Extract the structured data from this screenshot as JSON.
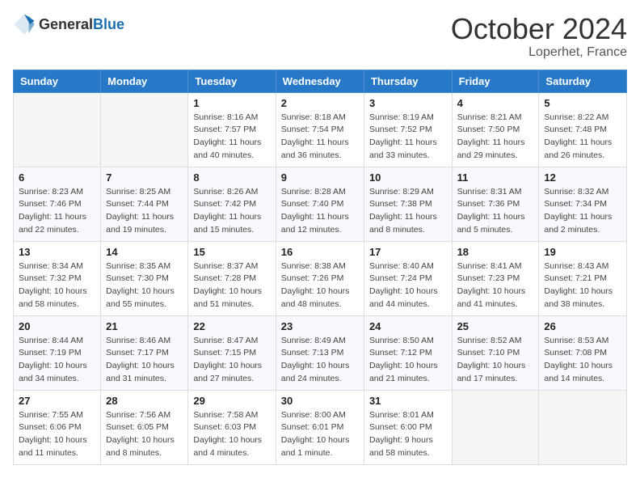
{
  "header": {
    "logo": {
      "general": "General",
      "blue": "Blue"
    },
    "month": "October 2024",
    "location": "Loperhet, France"
  },
  "days_of_week": [
    "Sunday",
    "Monday",
    "Tuesday",
    "Wednesday",
    "Thursday",
    "Friday",
    "Saturday"
  ],
  "weeks": [
    [
      {
        "day": "",
        "sunrise": "",
        "sunset": "",
        "daylight": ""
      },
      {
        "day": "",
        "sunrise": "",
        "sunset": "",
        "daylight": ""
      },
      {
        "day": "1",
        "sunrise": "Sunrise: 8:16 AM",
        "sunset": "Sunset: 7:57 PM",
        "daylight": "Daylight: 11 hours and 40 minutes."
      },
      {
        "day": "2",
        "sunrise": "Sunrise: 8:18 AM",
        "sunset": "Sunset: 7:54 PM",
        "daylight": "Daylight: 11 hours and 36 minutes."
      },
      {
        "day": "3",
        "sunrise": "Sunrise: 8:19 AM",
        "sunset": "Sunset: 7:52 PM",
        "daylight": "Daylight: 11 hours and 33 minutes."
      },
      {
        "day": "4",
        "sunrise": "Sunrise: 8:21 AM",
        "sunset": "Sunset: 7:50 PM",
        "daylight": "Daylight: 11 hours and 29 minutes."
      },
      {
        "day": "5",
        "sunrise": "Sunrise: 8:22 AM",
        "sunset": "Sunset: 7:48 PM",
        "daylight": "Daylight: 11 hours and 26 minutes."
      }
    ],
    [
      {
        "day": "6",
        "sunrise": "Sunrise: 8:23 AM",
        "sunset": "Sunset: 7:46 PM",
        "daylight": "Daylight: 11 hours and 22 minutes."
      },
      {
        "day": "7",
        "sunrise": "Sunrise: 8:25 AM",
        "sunset": "Sunset: 7:44 PM",
        "daylight": "Daylight: 11 hours and 19 minutes."
      },
      {
        "day": "8",
        "sunrise": "Sunrise: 8:26 AM",
        "sunset": "Sunset: 7:42 PM",
        "daylight": "Daylight: 11 hours and 15 minutes."
      },
      {
        "day": "9",
        "sunrise": "Sunrise: 8:28 AM",
        "sunset": "Sunset: 7:40 PM",
        "daylight": "Daylight: 11 hours and 12 minutes."
      },
      {
        "day": "10",
        "sunrise": "Sunrise: 8:29 AM",
        "sunset": "Sunset: 7:38 PM",
        "daylight": "Daylight: 11 hours and 8 minutes."
      },
      {
        "day": "11",
        "sunrise": "Sunrise: 8:31 AM",
        "sunset": "Sunset: 7:36 PM",
        "daylight": "Daylight: 11 hours and 5 minutes."
      },
      {
        "day": "12",
        "sunrise": "Sunrise: 8:32 AM",
        "sunset": "Sunset: 7:34 PM",
        "daylight": "Daylight: 11 hours and 2 minutes."
      }
    ],
    [
      {
        "day": "13",
        "sunrise": "Sunrise: 8:34 AM",
        "sunset": "Sunset: 7:32 PM",
        "daylight": "Daylight: 10 hours and 58 minutes."
      },
      {
        "day": "14",
        "sunrise": "Sunrise: 8:35 AM",
        "sunset": "Sunset: 7:30 PM",
        "daylight": "Daylight: 10 hours and 55 minutes."
      },
      {
        "day": "15",
        "sunrise": "Sunrise: 8:37 AM",
        "sunset": "Sunset: 7:28 PM",
        "daylight": "Daylight: 10 hours and 51 minutes."
      },
      {
        "day": "16",
        "sunrise": "Sunrise: 8:38 AM",
        "sunset": "Sunset: 7:26 PM",
        "daylight": "Daylight: 10 hours and 48 minutes."
      },
      {
        "day": "17",
        "sunrise": "Sunrise: 8:40 AM",
        "sunset": "Sunset: 7:24 PM",
        "daylight": "Daylight: 10 hours and 44 minutes."
      },
      {
        "day": "18",
        "sunrise": "Sunrise: 8:41 AM",
        "sunset": "Sunset: 7:23 PM",
        "daylight": "Daylight: 10 hours and 41 minutes."
      },
      {
        "day": "19",
        "sunrise": "Sunrise: 8:43 AM",
        "sunset": "Sunset: 7:21 PM",
        "daylight": "Daylight: 10 hours and 38 minutes."
      }
    ],
    [
      {
        "day": "20",
        "sunrise": "Sunrise: 8:44 AM",
        "sunset": "Sunset: 7:19 PM",
        "daylight": "Daylight: 10 hours and 34 minutes."
      },
      {
        "day": "21",
        "sunrise": "Sunrise: 8:46 AM",
        "sunset": "Sunset: 7:17 PM",
        "daylight": "Daylight: 10 hours and 31 minutes."
      },
      {
        "day": "22",
        "sunrise": "Sunrise: 8:47 AM",
        "sunset": "Sunset: 7:15 PM",
        "daylight": "Daylight: 10 hours and 27 minutes."
      },
      {
        "day": "23",
        "sunrise": "Sunrise: 8:49 AM",
        "sunset": "Sunset: 7:13 PM",
        "daylight": "Daylight: 10 hours and 24 minutes."
      },
      {
        "day": "24",
        "sunrise": "Sunrise: 8:50 AM",
        "sunset": "Sunset: 7:12 PM",
        "daylight": "Daylight: 10 hours and 21 minutes."
      },
      {
        "day": "25",
        "sunrise": "Sunrise: 8:52 AM",
        "sunset": "Sunset: 7:10 PM",
        "daylight": "Daylight: 10 hours and 17 minutes."
      },
      {
        "day": "26",
        "sunrise": "Sunrise: 8:53 AM",
        "sunset": "Sunset: 7:08 PM",
        "daylight": "Daylight: 10 hours and 14 minutes."
      }
    ],
    [
      {
        "day": "27",
        "sunrise": "Sunrise: 7:55 AM",
        "sunset": "Sunset: 6:06 PM",
        "daylight": "Daylight: 10 hours and 11 minutes."
      },
      {
        "day": "28",
        "sunrise": "Sunrise: 7:56 AM",
        "sunset": "Sunset: 6:05 PM",
        "daylight": "Daylight: 10 hours and 8 minutes."
      },
      {
        "day": "29",
        "sunrise": "Sunrise: 7:58 AM",
        "sunset": "Sunset: 6:03 PM",
        "daylight": "Daylight: 10 hours and 4 minutes."
      },
      {
        "day": "30",
        "sunrise": "Sunrise: 8:00 AM",
        "sunset": "Sunset: 6:01 PM",
        "daylight": "Daylight: 10 hours and 1 minute."
      },
      {
        "day": "31",
        "sunrise": "Sunrise: 8:01 AM",
        "sunset": "Sunset: 6:00 PM",
        "daylight": "Daylight: 9 hours and 58 minutes."
      },
      {
        "day": "",
        "sunrise": "",
        "sunset": "",
        "daylight": ""
      },
      {
        "day": "",
        "sunrise": "",
        "sunset": "",
        "daylight": ""
      }
    ]
  ]
}
